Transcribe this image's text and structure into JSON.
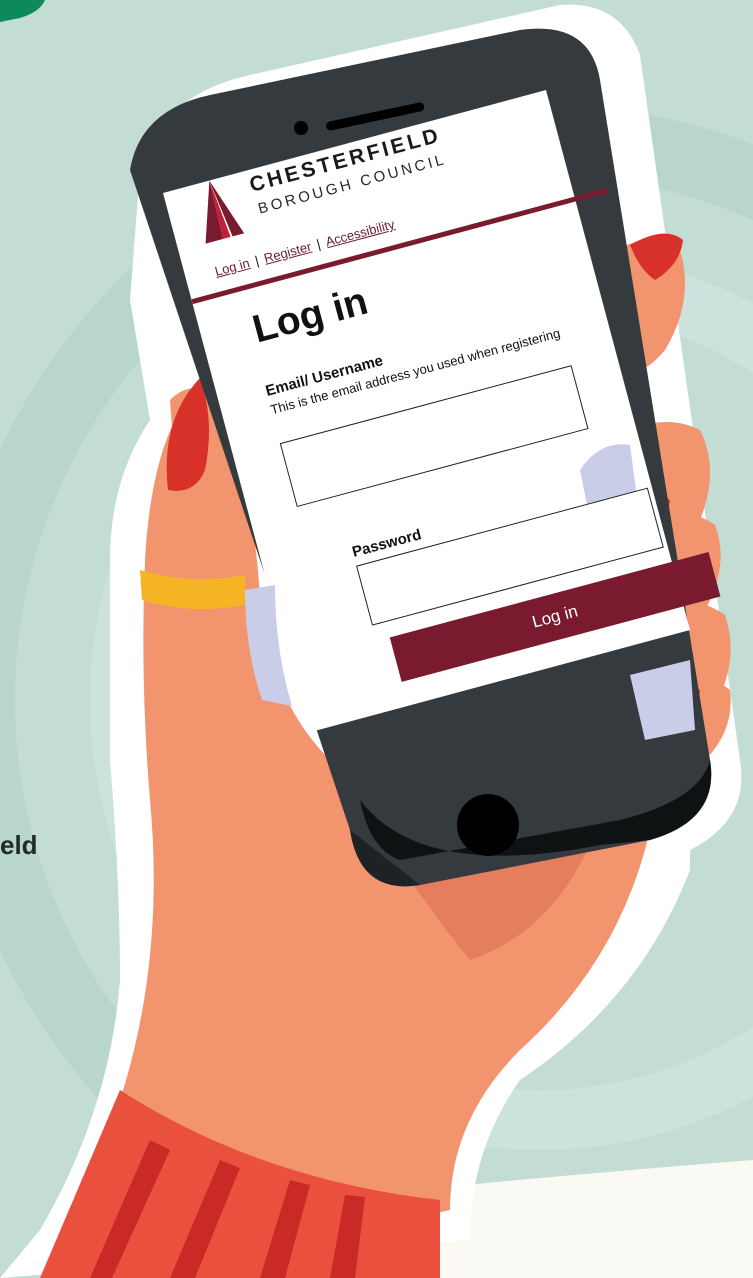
{
  "council": {
    "name_line1": "CHESTERFIELD",
    "name_line2": "BOROUGH COUNCIL"
  },
  "nav": {
    "login": "Log in",
    "register": "Register",
    "accessibility": "Accessibility",
    "separator": "|"
  },
  "form": {
    "title": "Log in",
    "email_label": "Email/ Username",
    "email_hint": "This is the email address you used when registering",
    "email_value": "",
    "password_label": "Password",
    "password_value": "",
    "submit_label": "Log in"
  },
  "background": {
    "partial_text": "eld"
  },
  "colors": {
    "brand_maroon": "#7a1a2e",
    "background_mint": "#c3ddd5",
    "skin": "#f2956e",
    "nail_red": "#d7312a",
    "ring_yellow": "#f5b424",
    "phone_body": "#343a3e"
  }
}
